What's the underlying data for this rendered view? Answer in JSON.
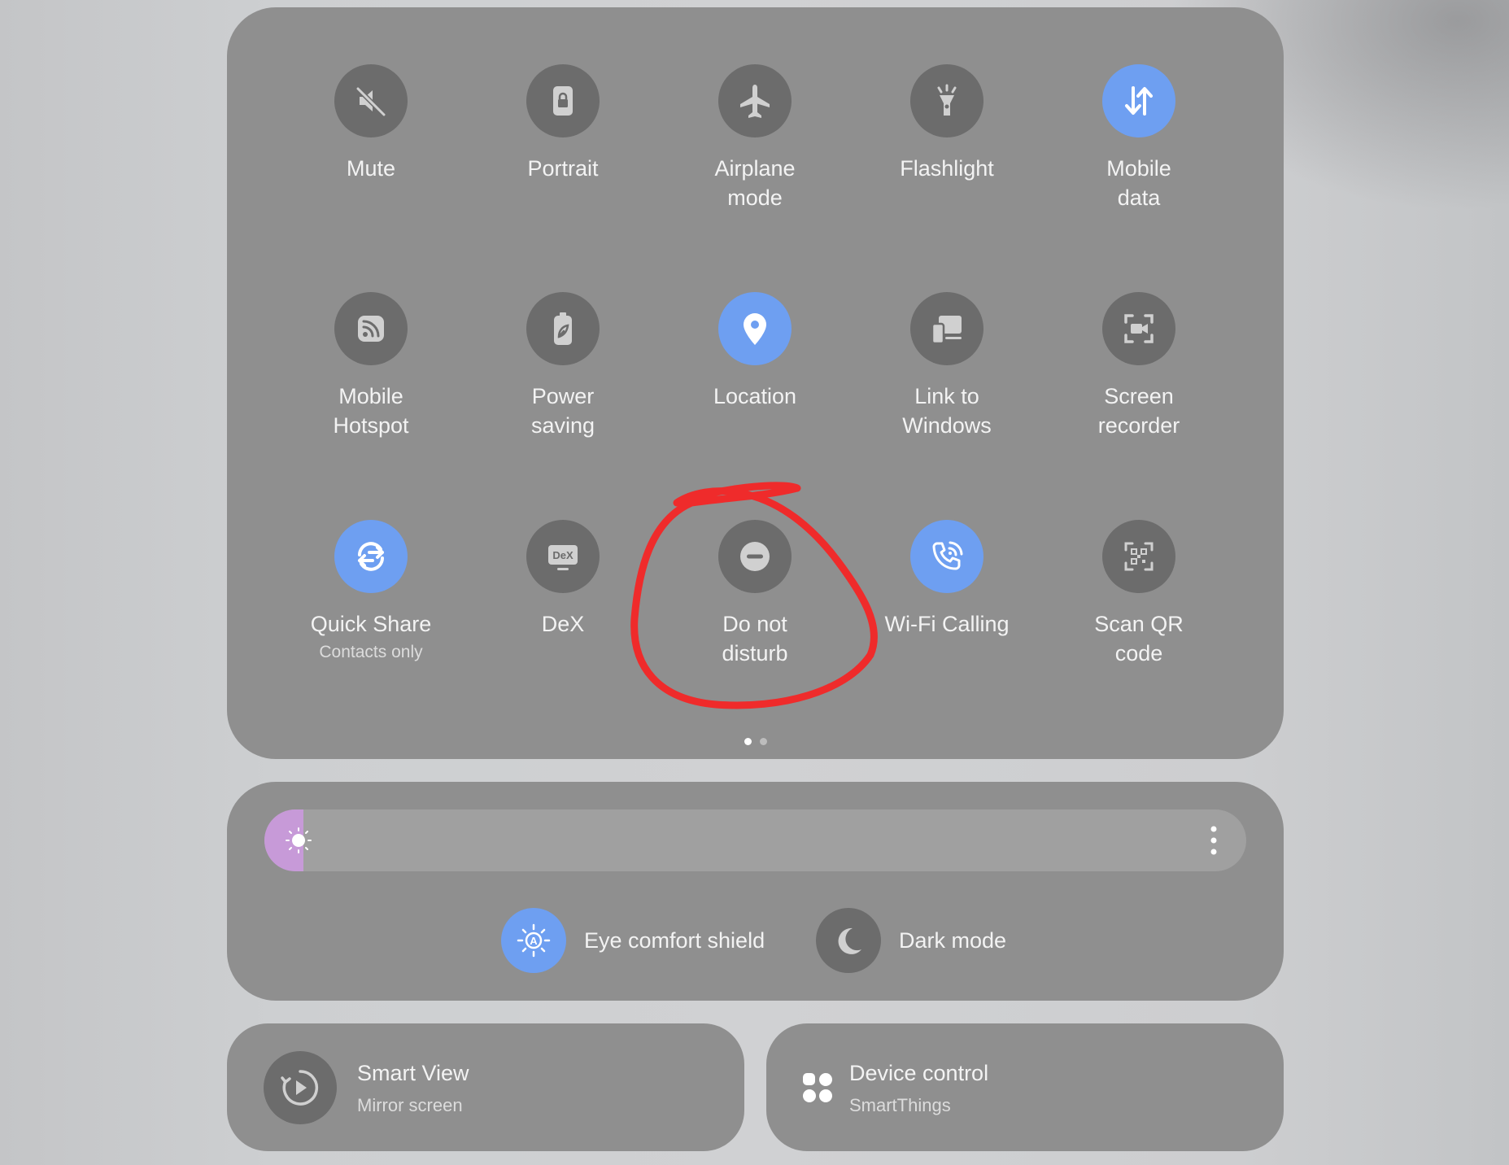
{
  "tiles": [
    {
      "label": "Mute",
      "icon": "mute-icon",
      "on": false
    },
    {
      "label": "Portrait",
      "icon": "portrait-lock-icon",
      "on": false
    },
    {
      "label": "Airplane\nmode",
      "icon": "airplane-icon",
      "on": false
    },
    {
      "label": "Flashlight",
      "icon": "flashlight-icon",
      "on": false
    },
    {
      "label": "Mobile\ndata",
      "icon": "mobile-data-icon",
      "on": true
    },
    {
      "label": "Mobile\nHotspot",
      "icon": "hotspot-icon",
      "on": false
    },
    {
      "label": "Power\nsaving",
      "icon": "power-saving-icon",
      "on": false
    },
    {
      "label": "Location",
      "icon": "location-pin-icon",
      "on": true
    },
    {
      "label": "Link to\nWindows",
      "icon": "link-to-windows-icon",
      "on": false
    },
    {
      "label": "Screen\nrecorder",
      "icon": "screen-recorder-icon",
      "on": false
    },
    {
      "label": "Quick Share",
      "sub": "Contacts only",
      "icon": "quick-share-icon",
      "on": true
    },
    {
      "label": "DeX",
      "icon": "dex-icon",
      "on": false
    },
    {
      "label": "Do not\ndisturb",
      "icon": "do-not-disturb-icon",
      "on": false
    },
    {
      "label": "Wi-Fi Calling",
      "icon": "wifi-calling-icon",
      "on": true
    },
    {
      "label": "Scan QR\ncode",
      "icon": "qr-scan-icon",
      "on": false
    }
  ],
  "pagination": {
    "pages": 2,
    "current": 1
  },
  "brightness": {
    "level_percent": 4
  },
  "toggles": {
    "eye_comfort": {
      "label": "Eye comfort shield",
      "on": true
    },
    "dark_mode": {
      "label": "Dark mode",
      "on": false
    }
  },
  "smart_view": {
    "title": "Smart View",
    "subtitle": "Mirror screen"
  },
  "device_control": {
    "title": "Device control",
    "subtitle": "SmartThings"
  },
  "colors": {
    "active": "#6e9ff1",
    "inactive": "#6c6c6c",
    "annotation": "#ef2b2b",
    "brightness_fill": "#c79ad8"
  }
}
